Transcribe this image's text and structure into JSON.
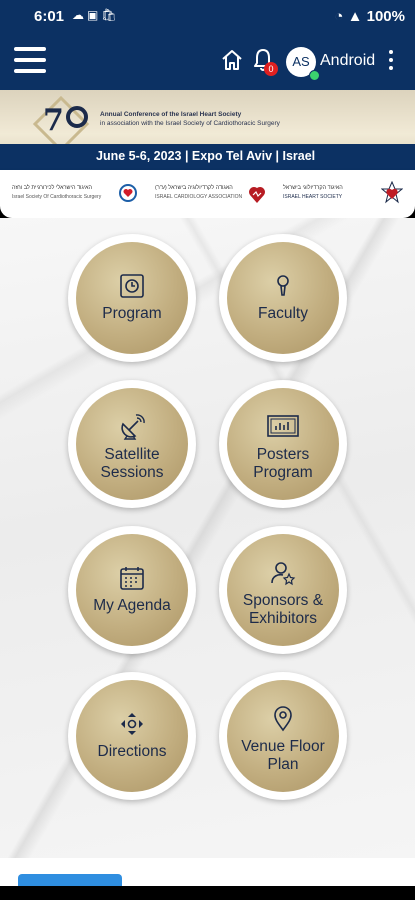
{
  "status_bar": {
    "time": "6:01",
    "battery": "100%"
  },
  "header": {
    "user_initials": "AS",
    "user_name": "Android",
    "notification_count": "0",
    "icons": [
      "menu-icon",
      "home-icon",
      "bell-icon",
      "more-icon"
    ]
  },
  "banner": {
    "line1": "Annual Conference of the Israel Heart Society",
    "line2": "in association with the Israel Society of Cardiothoracic Surgery",
    "date_line": "June 5-6, 2023 | Expo Tel Aviv | Israel"
  },
  "sponsors": [
    {
      "line1": "האיגוד הישראלי לכירורגיית לב וחזה",
      "line2": "Israel Society Of Cardiothoracic Surgery"
    },
    {
      "line1": "האגודה לקרדיולוגיה בישראל (ע\"ר)",
      "line2": "ISRAEL CARDIOLOGY ASSOCIATION"
    },
    {
      "line1": "האיגוד הקרדיולוגי בישראל",
      "line2": "ISRAEL HEART SOCIETY"
    }
  ],
  "menu": {
    "program": "Program",
    "faculty": "Faculty",
    "satellite_1": "Satellite",
    "satellite_2": "Sessions",
    "posters_1": "Posters",
    "posters_2": "Program",
    "agenda": "My Agenda",
    "sponsors_1": "Sponsors &",
    "sponsors_2": "Exhibitors",
    "directions": "Directions",
    "venue_1": "Venue Floor",
    "venue_2": "Plan"
  },
  "colors": {
    "navy": "#0c3163",
    "gold": "#c2ae80",
    "label": "#1d2b4a"
  }
}
